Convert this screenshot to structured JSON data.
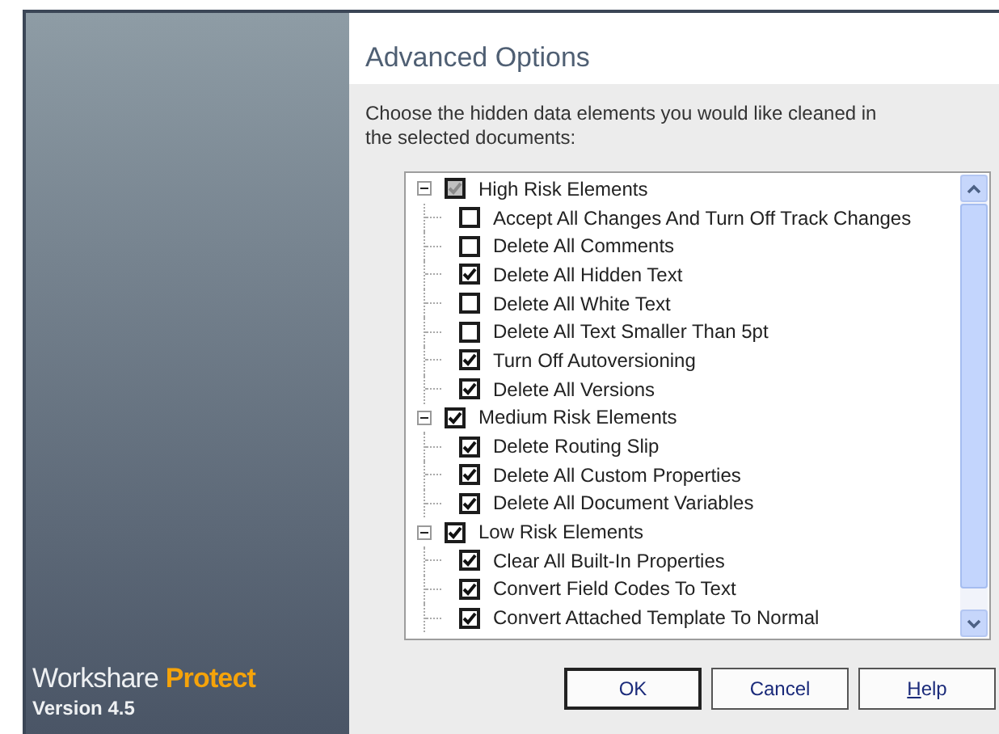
{
  "sidebar": {
    "brand": "Workshare",
    "product": "Protect",
    "version": "Version 4.5"
  },
  "title": "Advanced Options",
  "instructions": "Choose the hidden data elements you would like cleaned in the selected documents:",
  "tree": [
    {
      "label": "High Risk Elements",
      "expanded": true,
      "checked": true,
      "partial": true,
      "children": [
        {
          "label": "Accept All Changes And Turn Off Track Changes",
          "checked": false
        },
        {
          "label": "Delete All Comments",
          "checked": false
        },
        {
          "label": "Delete All Hidden Text",
          "checked": true
        },
        {
          "label": "Delete All White Text",
          "checked": false
        },
        {
          "label": "Delete All Text Smaller Than 5pt",
          "checked": false
        },
        {
          "label": "Turn Off Autoversioning",
          "checked": true
        },
        {
          "label": "Delete All Versions",
          "checked": true
        }
      ]
    },
    {
      "label": "Medium Risk Elements",
      "expanded": true,
      "checked": true,
      "partial": false,
      "children": [
        {
          "label": "Delete Routing Slip",
          "checked": true
        },
        {
          "label": "Delete All Custom Properties",
          "checked": true
        },
        {
          "label": "Delete All Document Variables",
          "checked": true
        }
      ]
    },
    {
      "label": "Low Risk Elements",
      "expanded": true,
      "checked": true,
      "partial": false,
      "children": [
        {
          "label": "Clear All Built-In Properties",
          "checked": true
        },
        {
          "label": "Convert Field Codes To Text",
          "checked": true
        },
        {
          "label": "Convert Attached Template To Normal",
          "checked": true
        }
      ]
    }
  ],
  "buttons": [
    {
      "label": "OK",
      "kind": "default"
    },
    {
      "label": "Cancel",
      "kind": "normal"
    },
    {
      "label": "Help",
      "kind": "help"
    }
  ]
}
